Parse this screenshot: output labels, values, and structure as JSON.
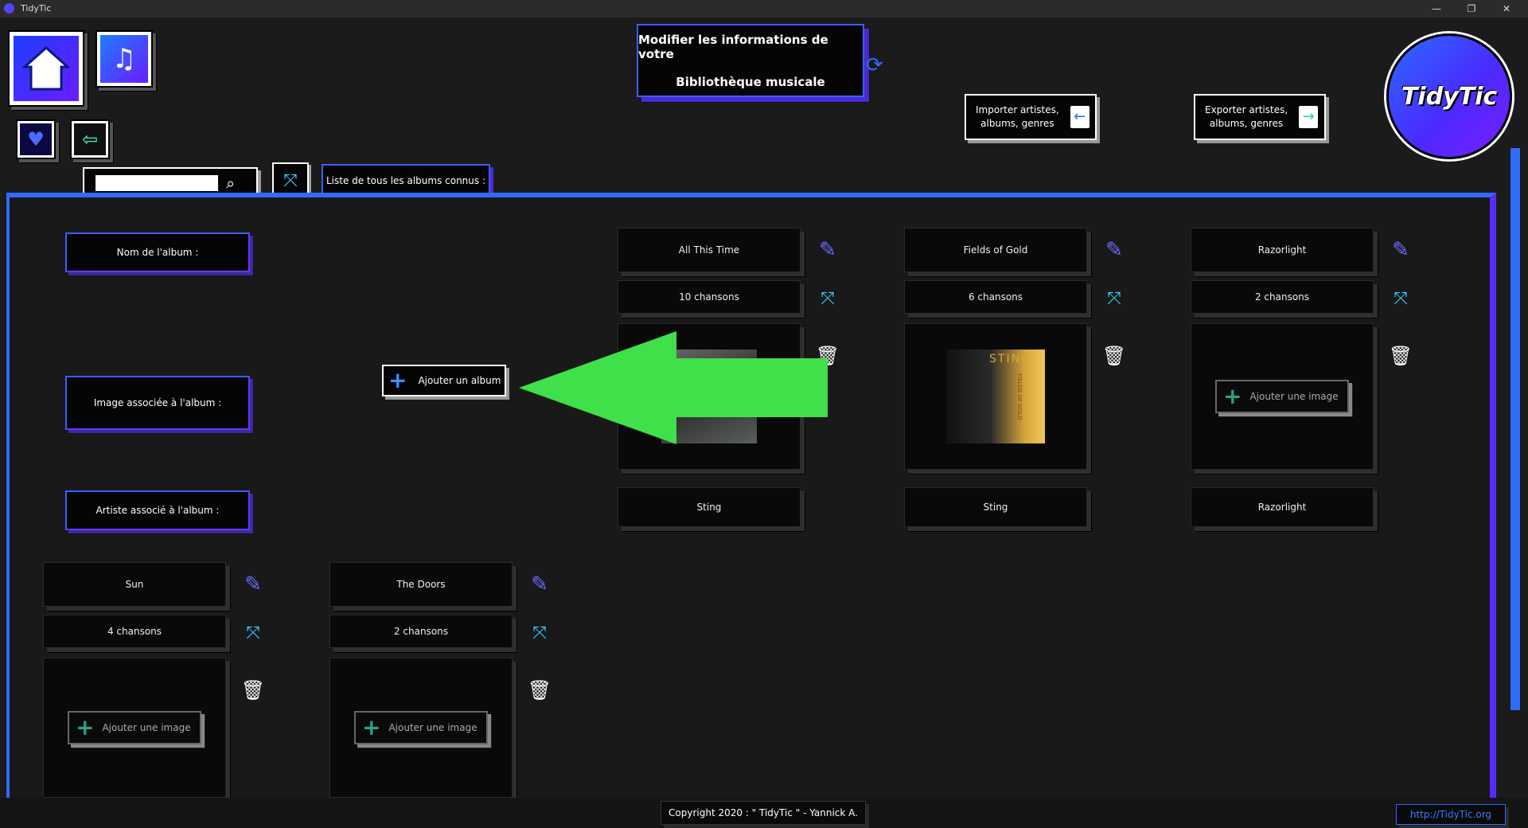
{
  "window": {
    "title": "TidyTic",
    "minimize": "—",
    "restore": "❐",
    "close": "✕"
  },
  "header": {
    "title_line1": "Modifier les informations de votre",
    "title_line2": "Bibliothèque musicale",
    "import_label_1": "Importer artistes,",
    "import_label_2": "albums, genres",
    "export_label_1": "Exporter artistes,",
    "export_label_2": "albums, genres",
    "logo_text": "TidyTic"
  },
  "toolbar": {
    "search_placeholder": "",
    "list_label": "Liste de tous les albums connus :"
  },
  "fields": {
    "album_name": "Nom de l'album :",
    "album_image": "Image associée à l'album :",
    "album_artist": "Artiste associé à l'album :",
    "add_album": "Ajouter un album"
  },
  "albums": [
    {
      "name": "All This Time",
      "songs": "10 chansons",
      "artist": "Sting",
      "image": "cover-photo"
    },
    {
      "name": "Fields of Gold",
      "songs": "6 chansons",
      "artist": "Sting",
      "image": "sting-cover",
      "cover_text": "STING",
      "cover_sub": "FIELDS OF GOLD"
    },
    {
      "name": "Razorlight",
      "songs": "2 chansons",
      "artist": "Razorlight",
      "image": "none",
      "add_image": "Ajouter une image"
    },
    {
      "name": "Sun",
      "songs": "4 chansons",
      "artist": "",
      "image": "none",
      "add_image": "Ajouter une image"
    },
    {
      "name": "The Doors",
      "songs": "2 chansons",
      "artist": "",
      "image": "none",
      "add_image": "Ajouter une image"
    }
  ],
  "footer": {
    "copyright": "Copyright 2020 : \" TidyTic \" - Yannick A.",
    "link": "http://TidyTic.org"
  },
  "colors": {
    "accent_blue": "#2f6bff",
    "accent_purple": "#6b2bff",
    "arrow_green": "#3fe04a",
    "bg": "#1b1b1b"
  }
}
